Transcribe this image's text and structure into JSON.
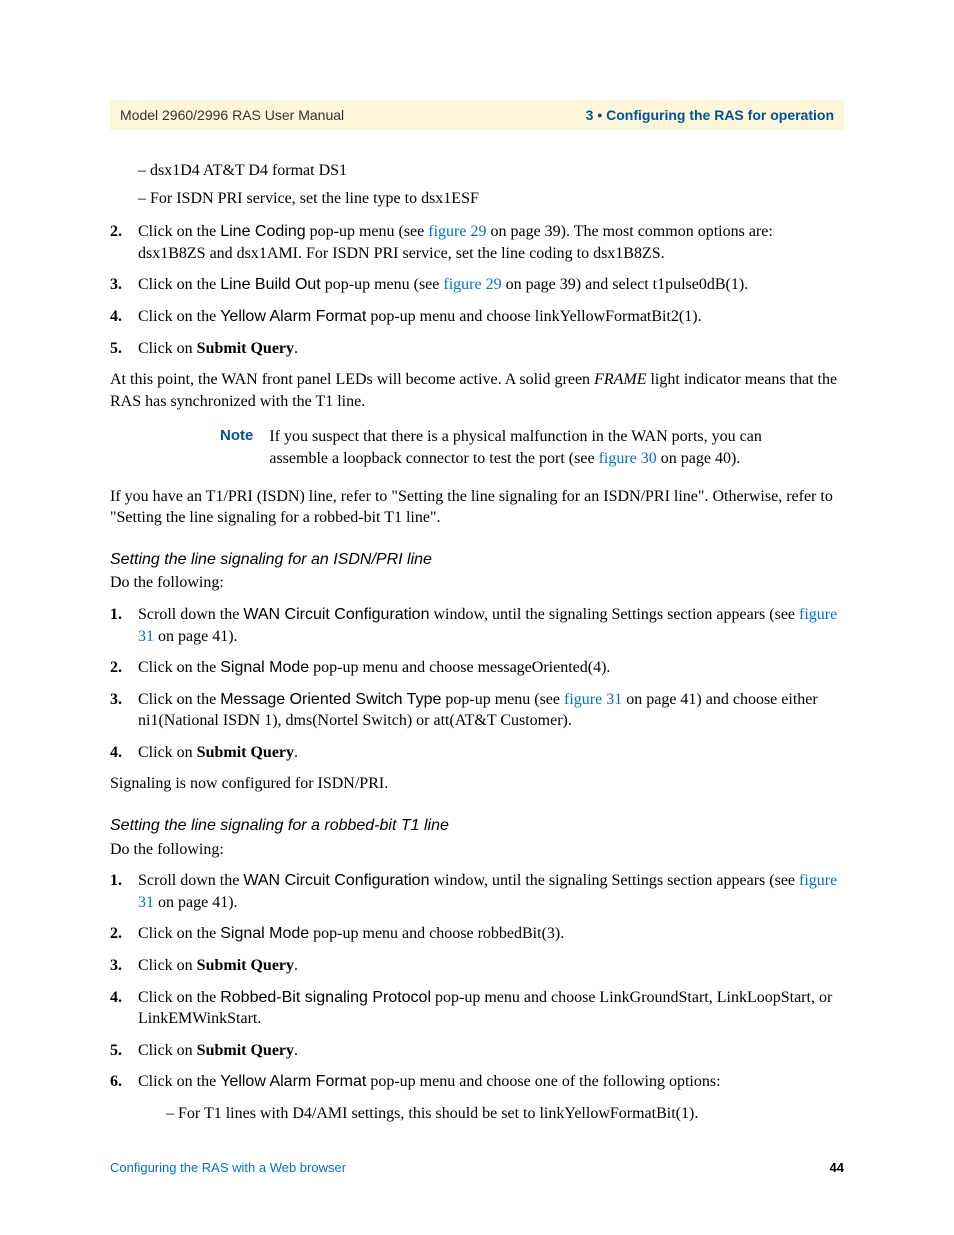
{
  "header": {
    "left": "Model 2960/2996 RAS User Manual",
    "right": "3 • Configuring the RAS for operation"
  },
  "intro_bullets": [
    "– dsx1D4 AT&T D4 format DS1",
    "– For ISDN PRI service, set the line type to dsx1ESF"
  ],
  "list1": {
    "item2": {
      "num": "2.",
      "t1": "Click on the ",
      "ui1": "Line Coding",
      "t2": " pop-up menu (see ",
      "link": "figure 29",
      "t3": " on page 39). The most common options are: dsx1B8ZS and dsx1AMI. For ISDN PRI service, set the line coding to dsx1B8ZS."
    },
    "item3": {
      "num": "3.",
      "t1": "Click on the ",
      "ui1": "Line Build Out",
      "t2": " pop-up menu (see ",
      "link": "figure 29",
      "t3": " on page 39) and select t1pulse0dB(1)."
    },
    "item4": {
      "num": "4.",
      "t1": "Click on the ",
      "ui1": "Yellow Alarm Format",
      "t2": " pop-up menu and choose linkYellowFormatBit2(1)."
    },
    "item5": {
      "num": "5.",
      "t1": "Click on ",
      "bold": "Submit Query",
      "t2": "."
    }
  },
  "para1": {
    "t1": "At this point, the WAN front panel LEDs will become active. A solid green ",
    "italic": "FRAME",
    "t2": " light indicator means that the RAS has synchronized with the T1 line."
  },
  "note": {
    "label": "Note",
    "t1": "If you suspect that there is a physical malfunction in the WAN ports, you can assemble a loopback connector to test the port (see ",
    "link": "figure 30",
    "t2": " on page 40)."
  },
  "para2": "If you have an T1/PRI (ISDN) line, refer to \"Setting the line signaling for an ISDN/PRI line\". Otherwise, refer to \"Setting the line signaling for a robbed-bit T1 line\".",
  "section1": {
    "heading": "Setting the line signaling for an ISDN/PRI line",
    "intro": "Do the following:",
    "items": {
      "i1": {
        "num": "1.",
        "t1": "Scroll down the ",
        "ui1": "WAN Circuit Configuration",
        "t2": " window, until the signaling Settings section appears (see ",
        "link": "figure 31",
        "t3": " on page 41)."
      },
      "i2": {
        "num": "2.",
        "t1": "Click on the ",
        "ui1": "Signal Mode",
        "t2": " pop-up menu and choose messageOriented(4)."
      },
      "i3": {
        "num": "3.",
        "t1": "Click on the ",
        "ui1": "Message Oriented Switch Type",
        "t2": " pop-up menu (see ",
        "link": "figure 31",
        "t3": " on page 41) and choose either ni1(National ISDN 1), dms(Nortel Switch) or att(AT&T Customer)."
      },
      "i4": {
        "num": "4.",
        "t1": "Click on ",
        "bold": "Submit Query",
        "t2": "."
      }
    },
    "after": "Signaling is now configured for ISDN/PRI."
  },
  "section2": {
    "heading": "Setting the line signaling for a robbed-bit T1 line",
    "intro": "Do the following:",
    "items": {
      "i1": {
        "num": "1.",
        "t1": "Scroll down the ",
        "ui1": "WAN Circuit Configuration",
        "t2": " window, until the signaling Settings section appears (see ",
        "link": "figure 31",
        "t3": " on page 41)."
      },
      "i2": {
        "num": "2.",
        "t1": "Click on the ",
        "ui1": "Signal Mode",
        "t2": " pop-up menu and choose robbedBit(3)."
      },
      "i3": {
        "num": "3.",
        "t1": "Click on ",
        "bold": "Submit Query",
        "t2": "."
      },
      "i4": {
        "num": "4.",
        "t1": "Click on the ",
        "ui1": "Robbed-Bit signaling Protocol",
        "t2": " pop-up menu and choose LinkGroundStart, LinkLoopStart, or LinkEMWinkStart."
      },
      "i5": {
        "num": "5.",
        "t1": "Click on ",
        "bold": "Submit Query",
        "t2": "."
      },
      "i6": {
        "num": "6.",
        "t1": "Click on the ",
        "ui1": "Yellow Alarm Format",
        "t2": " pop-up menu and choose one of the following options:",
        "sub": "– For T1 lines with D4/AMI settings, this should be set to linkYellowFormatBit(1)."
      }
    }
  },
  "footer": {
    "left": "Configuring the RAS with a Web browser",
    "right": "44"
  }
}
